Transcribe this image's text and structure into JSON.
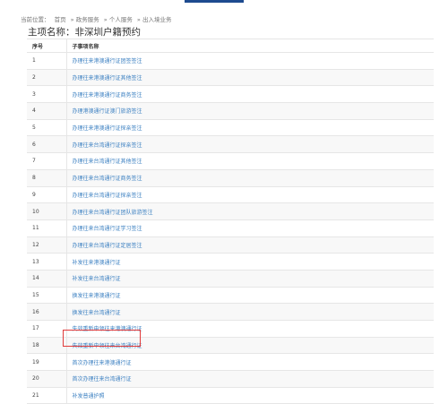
{
  "breadcrumb": {
    "prefix": "当前位置：",
    "items": [
      "首页",
      "» 政务服务",
      "» 个人服务",
      "» 出入境业务"
    ]
  },
  "main_title": "主项名称：非深圳户籍预约",
  "table": {
    "headers": [
      "序号",
      "子事项名称"
    ],
    "rows": [
      {
        "no": "1",
        "name": "办理往来港澳通行证团签签注"
      },
      {
        "no": "2",
        "name": "办理往来港澳通行证其他签注"
      },
      {
        "no": "3",
        "name": "办理往来港澳通行证商务签注"
      },
      {
        "no": "4",
        "name": "办理港澳通行证澳门旅游签注"
      },
      {
        "no": "5",
        "name": "办理往来港澳通行证探亲签注"
      },
      {
        "no": "6",
        "name": "办理往来台湾通行证探亲签注"
      },
      {
        "no": "7",
        "name": "办理往来台湾通行证其他签注"
      },
      {
        "no": "8",
        "name": "办理往来台湾通行证商务签注"
      },
      {
        "no": "9",
        "name": "办理往来台湾通行证探亲签注"
      },
      {
        "no": "10",
        "name": "办理往来台湾通行证团队旅游签注"
      },
      {
        "no": "11",
        "name": "办理往来台湾通行证学习签注"
      },
      {
        "no": "12",
        "name": "办理往来台湾通行证定居签注"
      },
      {
        "no": "13",
        "name": "补发往来港澳通行证"
      },
      {
        "no": "14",
        "name": "补发往来台湾通行证"
      },
      {
        "no": "15",
        "name": "换发往来港澳通行证"
      },
      {
        "no": "16",
        "name": "换发往来台湾通行证"
      },
      {
        "no": "17",
        "name": "失效重新申领往来港澳通行证"
      },
      {
        "no": "18",
        "name": "失效重新申领往来台湾通行证"
      },
      {
        "no": "19",
        "name": "首次办理往来港澳通行证"
      },
      {
        "no": "20",
        "name": "首次办理往来台湾通行证"
      },
      {
        "no": "21",
        "name": "补发普通护照"
      }
    ]
  },
  "colors": {
    "link": "#3a7fc1",
    "highlight_border": "#e03a3a",
    "top_tab": "#1e4b8f"
  }
}
